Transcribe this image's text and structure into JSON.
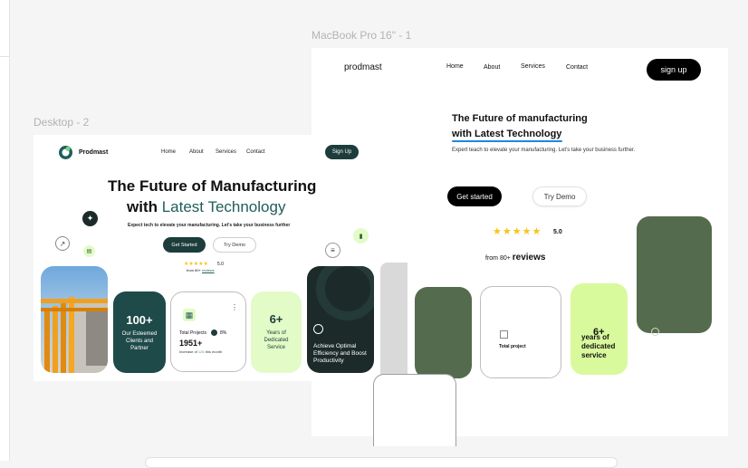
{
  "frames": {
    "macbook_label": "MacBook Pro 16\" - 1",
    "desktop_label": "Desktop - 2"
  },
  "desktop": {
    "brand": "Prodmast",
    "nav": [
      "Home",
      "About",
      "Services",
      "Contact"
    ],
    "signup": "Sign Up",
    "hero_line1": "The Future of Manufacturing",
    "hero_line2_prefix": "with ",
    "hero_line2_highlight": "Latest Technology",
    "subtitle": "Expect tech to elevate your manufacturing. Let's take your business further",
    "get_started": "Get Started",
    "try_demo": "Try Demo",
    "stars": "★★★★★",
    "rating": "5.0",
    "from_text": "from 80+ ",
    "reviews_text": "reviews",
    "clients_number": "100+",
    "clients_text": "Our Esteemed Clients and Partner",
    "projects_label": "Total Projects",
    "projects_pct": "8%",
    "projects_number": "1951+",
    "projects_increase_prefix": "Increase of ",
    "projects_increase_value": "126",
    "projects_increase_suffix": " this month",
    "years_number": "6+",
    "years_text": "Years of Dedicated Service",
    "efficiency_text": "Achieve Optimal Efficiency and Boost Productivity",
    "colors": {
      "dark_teal": "#1f4a4a",
      "lime": "#e3fbc7",
      "dark": "#1c2b2a",
      "accent": "#1f5d5a"
    }
  },
  "macbook": {
    "brand": "prodmast",
    "nav": [
      "Home",
      "About",
      "Services",
      "Contact"
    ],
    "signup": "sign up",
    "hero_line1": "The Future of manufacturing",
    "hero_line2": "with Latest Technology",
    "subtitle": "Expert teach to elevate your manufacturing. Let's take your business further.",
    "get_started": "Get started",
    "try_demo": "Try Demo",
    "stars": "★★★★★",
    "rating": "5.0",
    "from_text": "from 80+ ",
    "reviews_text": "reviews",
    "total_project": "Total project",
    "years_number": "6+",
    "years_text": "years of dedicated service",
    "colors": {
      "olive": "#556b4e",
      "lime": "#d9f99d",
      "star": "#f5c518",
      "underline": "#1e88e5"
    }
  }
}
